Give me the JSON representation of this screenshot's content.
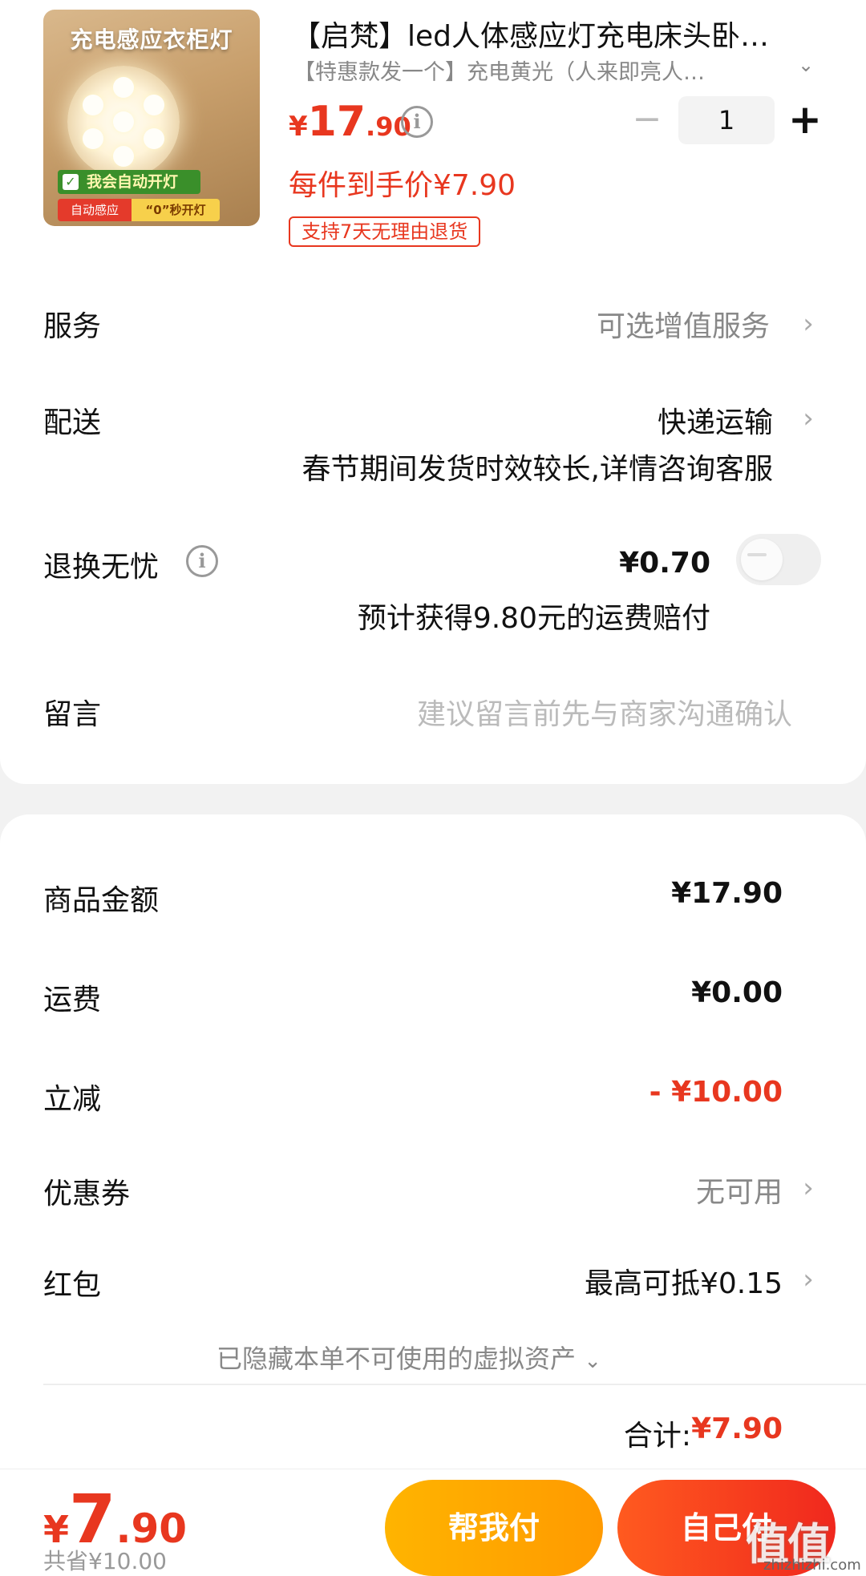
{
  "product": {
    "image_text": {
      "title": "充电感应衣柜灯",
      "green_badge": "我会自动开灯",
      "red_badge": "自动感应",
      "yellow_badge": "“0”秒开灯"
    },
    "title": "【启梵】led人体感应灯充电床头卧…",
    "spec": "【特惠款发一个】充电黄光（人来即亮人…",
    "price": {
      "currency": "¥",
      "integer": "17",
      "decimal": ".90"
    },
    "quantity": "1",
    "deal_price": "每件到手价¥7.90",
    "return_tag": "支持7天无理由退货"
  },
  "rows": {
    "service": {
      "label": "服务",
      "value": "可选增值服务"
    },
    "delivery": {
      "label": "配送",
      "value": "快递运输",
      "note": "春节期间发货时效较长,详情咨询客服"
    },
    "return_worry": {
      "label": "退换无忧",
      "value": "¥0.70",
      "note": "预计获得9.80元的运费赔付",
      "toggle_on": false
    },
    "message": {
      "label": "留言",
      "placeholder": "建议留言前先与商家沟通确认"
    }
  },
  "summary": {
    "goods": {
      "label": "商品金额",
      "value": "¥17.90"
    },
    "shipping": {
      "label": "运费",
      "value": "¥0.00"
    },
    "discount": {
      "label": "立减",
      "value": "- ¥10.00"
    },
    "coupon": {
      "label": "优惠券",
      "value": "无可用"
    },
    "red_packet": {
      "label": "红包",
      "value": "最高可抵¥0.15"
    },
    "hidden_assets": "已隐藏本单不可使用的虚拟资产",
    "total_label": "合计:",
    "total_value": "¥7.90"
  },
  "bottom": {
    "price": {
      "currency": "¥",
      "integer": "7",
      "decimal": ".90"
    },
    "saved": "共省¥10.00",
    "help_pay": "帮我付",
    "self_pay": "自己付",
    "watermark": "值值值",
    "watermark_url": "zhizhizhi.com"
  },
  "colors": {
    "accent": "#e8371f",
    "help_button": "#ffa800",
    "self_button": "#f0281e"
  }
}
